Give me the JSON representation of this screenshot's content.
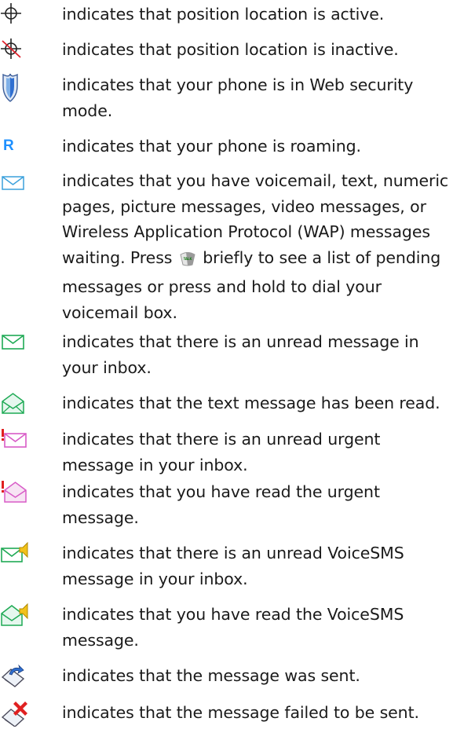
{
  "items": [
    {
      "icon": "position-active-icon",
      "text": "indicates that position location is active."
    },
    {
      "icon": "position-inactive-icon",
      "text": "indicates that position location is inactive."
    },
    {
      "icon": "web-security-shield-icon",
      "text": "indicates that your phone is in Web security mode."
    },
    {
      "icon": "roaming-icon",
      "symbol": "R",
      "text": "indicates that your phone is roaming."
    },
    {
      "icon": "voicemail-envelope-icon",
      "text_before": "indicates that you have voicemail, text, numeric pages, picture messages, video messages, or Wireless Application Protocol (WAP) messages waiting. Press",
      "key_icon": "talk-key-icon",
      "key_label": "TALK",
      "text_after": "briefly to see a list of pending messages or press and hold to dial your voicemail box."
    },
    {
      "icon": "unread-message-icon",
      "text": "indicates that there is an unread message in your inbox."
    },
    {
      "icon": "read-message-icon",
      "text": "indicates that the text message has been read."
    },
    {
      "icon": "unread-urgent-message-icon",
      "text": "indicates that there is an unread urgent message in your inbox."
    },
    {
      "icon": "read-urgent-message-icon",
      "text": "indicates that you have read the urgent message."
    },
    {
      "icon": "unread-voicesms-icon",
      "text": "indicates that there is an unread VoiceSMS message in your inbox."
    },
    {
      "icon": "read-voicesms-icon",
      "text": "indicates that you have read the VoiceSMS message."
    },
    {
      "icon": "message-sent-icon",
      "text": "indicates that the message was sent."
    },
    {
      "icon": "message-failed-icon",
      "text": "indicates that the message failed to be sent."
    }
  ]
}
